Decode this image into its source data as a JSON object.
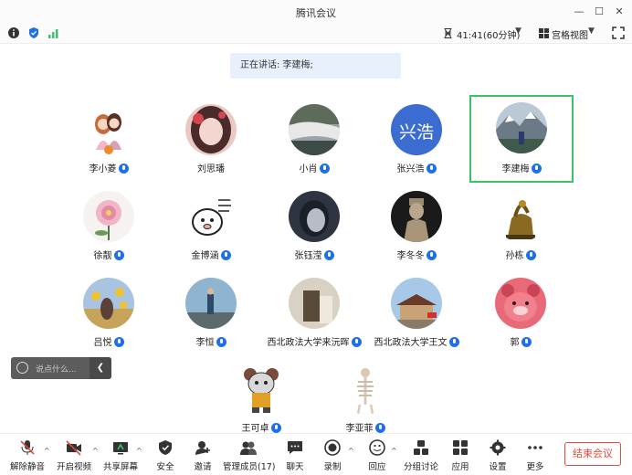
{
  "window": {
    "title": "腾讯会议"
  },
  "status": {
    "timer": "41:41(60分钟)",
    "view_label": "宫格视图"
  },
  "speaking": {
    "text": "正在讲话: 李建梅;"
  },
  "participants": [
    {
      "name": "李小菱",
      "mic": true
    },
    {
      "name": "刘思璠",
      "mic": false
    },
    {
      "name": "小肖",
      "mic": true
    },
    {
      "name": "张兴浩",
      "mic": true,
      "avatar_text": "兴浩"
    },
    {
      "name": "李建梅",
      "mic": true,
      "active": true
    },
    {
      "name": "徐靓",
      "mic": true
    },
    {
      "name": "金博涵",
      "mic": true
    },
    {
      "name": "张钰滢",
      "mic": true
    },
    {
      "name": "李冬冬",
      "mic": true
    },
    {
      "name": "孙栋",
      "mic": true
    },
    {
      "name": "吕悦",
      "mic": true
    },
    {
      "name": "李恒",
      "mic": true
    },
    {
      "name": "西北政法大学来沅晖",
      "mic": true
    },
    {
      "name": "西北政法大学王文",
      "mic": true
    },
    {
      "name": "郭",
      "mic": true
    },
    {
      "name": "王可卓",
      "mic": true
    },
    {
      "name": "李亚菲",
      "mic": true
    }
  ],
  "chat": {
    "placeholder": "说点什么..."
  },
  "toolbar": {
    "unmute": "解除静音",
    "video": "开启视频",
    "share": "共享屏幕",
    "security": "安全",
    "invite": "邀请",
    "members": "管理成员(17)",
    "chat": "聊天",
    "record": "录制",
    "react": "回应",
    "breakout": "分组讨论",
    "apps": "应用",
    "settings": "设置",
    "more": "更多",
    "end": "结束会议"
  },
  "colors": {
    "accent": "#1f6fe6",
    "active_border": "#3ec268",
    "end": "#e34a3b"
  }
}
